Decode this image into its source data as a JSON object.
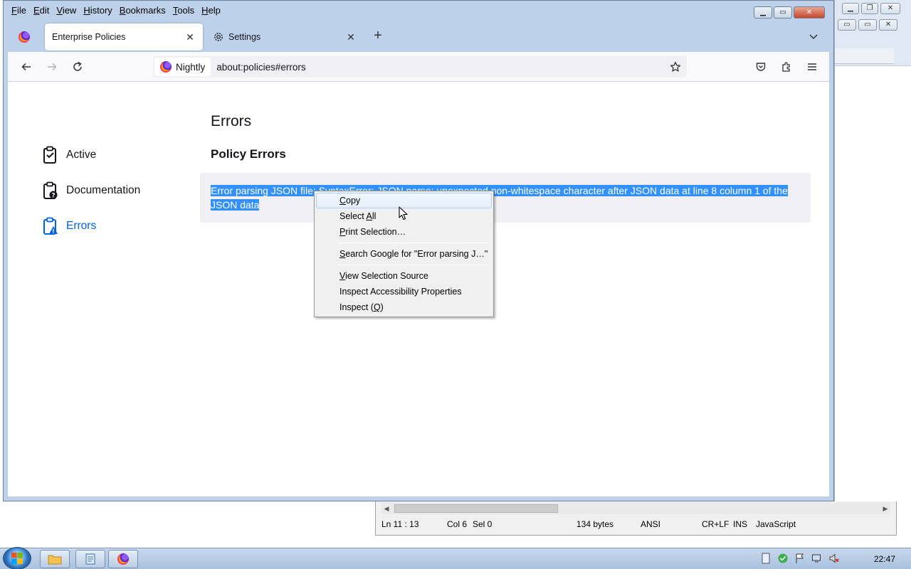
{
  "menubar": {
    "items": [
      {
        "label": "File",
        "key": "F",
        "rest": "ile"
      },
      {
        "label": "Edit",
        "key": "E",
        "rest": "dit"
      },
      {
        "label": "View",
        "key": "V",
        "rest": "iew"
      },
      {
        "label": "History",
        "key": "H",
        "rest": "istory"
      },
      {
        "label": "Bookmarks",
        "key": "B",
        "rest": "ookmarks"
      },
      {
        "label": "Tools",
        "key": "T",
        "rest": "ools"
      },
      {
        "label": "Help",
        "key": "H",
        "rest": "elp"
      }
    ]
  },
  "tabs": [
    {
      "label": "Enterprise Policies",
      "icon": "firefox-logo-icon",
      "selected": true
    },
    {
      "label": "Settings",
      "icon": "gear-icon",
      "selected": false
    }
  ],
  "navbar": {
    "identity_label": "Nightly",
    "url": "about:policies#errors"
  },
  "sidebar": {
    "items": [
      {
        "label": "Active",
        "icon": "clipboard-check-icon",
        "selected": false
      },
      {
        "label": "Documentation",
        "icon": "clipboard-question-icon",
        "selected": false
      },
      {
        "label": "Errors",
        "icon": "clipboard-warning-icon",
        "selected": true
      }
    ]
  },
  "main": {
    "title": "Errors",
    "section_title": "Policy Errors",
    "error_text": "Error parsing JSON file: SyntaxError: JSON.parse: unexpected non-whitespace character after JSON data at line 8 column 1 of the JSON data"
  },
  "context_menu": {
    "items": [
      {
        "pre": "",
        "key": "C",
        "post": "opy",
        "hover": true
      },
      {
        "pre": "Select ",
        "key": "A",
        "post": "ll",
        "hover": false
      },
      {
        "pre": "",
        "key": "P",
        "post": "rint Selection…",
        "hover": false
      },
      {
        "sep": true
      },
      {
        "pre": "",
        "key": "S",
        "post": "earch Google for \"Error parsing J…\"",
        "hover": false
      },
      {
        "sep": true
      },
      {
        "pre": "",
        "key": "V",
        "post": "iew Selection Source",
        "hover": false
      },
      {
        "pre": "Inspect Accessibility Properties",
        "key": "",
        "post": "",
        "hover": false
      },
      {
        "pre": "Inspect (",
        "key": "Q",
        "post": ")",
        "hover": false
      }
    ]
  },
  "editor_status": {
    "position": "Ln 11 : 13",
    "col": "Col 6",
    "sel": "Sel 0",
    "size": "134 bytes",
    "encoding": "ANSI",
    "eol": "CR+LF",
    "mode": "INS",
    "language": "JavaScript"
  },
  "taskbar": {
    "clock": "22:47"
  },
  "colors": {
    "accent": "#0061e0",
    "selection": "#3390ff"
  }
}
